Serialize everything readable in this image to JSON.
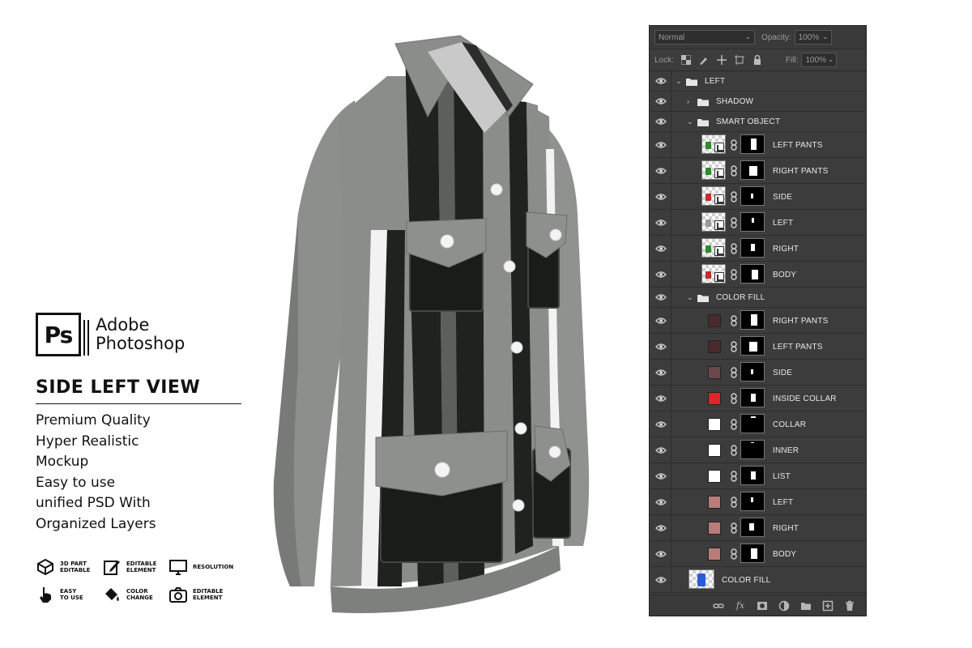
{
  "brand": {
    "logo_text": "Ps",
    "name_line1": "Adobe",
    "name_line2": "Photoshop"
  },
  "view_title": "SIDE LEFT VIEW",
  "features": [
    "Premium Quality",
    "Hyper Realistic",
    "Mockup",
    "Easy to use",
    "unified PSD With",
    "Organized Layers"
  ],
  "badges": [
    {
      "icon": "3d-cube-icon",
      "line1": "3D PART",
      "line2": "EDITABLE"
    },
    {
      "icon": "edit-icon",
      "line1": "EDITABLE",
      "line2": "ELEMENT"
    },
    {
      "icon": "monitor-icon",
      "line1": "RESOLUTION",
      "line2": ""
    },
    {
      "icon": "hand-pointer-icon",
      "line1": "EASY",
      "line2": "TO USE"
    },
    {
      "icon": "paint-bucket-icon",
      "line1": "COLOR",
      "line2": "CHANGE"
    },
    {
      "icon": "camera-icon",
      "line1": "EDITABLE",
      "line2": "ELEMENT"
    }
  ],
  "layers_panel": {
    "blend_mode": "Normal",
    "opacity_label": "Opacity:",
    "opacity_value": "100%",
    "lock_label": "Lock:",
    "fill_label": "Fill:",
    "fill_value": "100%",
    "layers": [
      {
        "name": "LEFT",
        "type": "group",
        "expanded": true
      },
      {
        "name": "SHADOW",
        "type": "group",
        "expanded": false
      },
      {
        "name": "SMART OBJECT",
        "type": "group",
        "expanded": true
      },
      {
        "name": "LEFT PANTS",
        "type": "smart"
      },
      {
        "name": "RIGHT PANTS",
        "type": "smart"
      },
      {
        "name": "SIDE",
        "type": "smart"
      },
      {
        "name": "LEFT",
        "type": "smart"
      },
      {
        "name": "RIGHT",
        "type": "smart"
      },
      {
        "name": "BODY",
        "type": "smart"
      },
      {
        "name": "COLOR FILL",
        "type": "group",
        "expanded": true
      },
      {
        "name": "RIGHT PANTS",
        "type": "fill",
        "color": "#4a2a2d"
      },
      {
        "name": "LEFT PANTS",
        "type": "fill",
        "color": "#4a2a2d"
      },
      {
        "name": "SIDE",
        "type": "fill",
        "color": "#6b464a"
      },
      {
        "name": "INSIDE COLLAR",
        "type": "fill",
        "color": "#e0222a"
      },
      {
        "name": "COLLAR",
        "type": "fill",
        "color": "#ffffff"
      },
      {
        "name": "INNER",
        "type": "fill",
        "color": "#ffffff"
      },
      {
        "name": "LIST",
        "type": "fill",
        "color": "#ffffff"
      },
      {
        "name": "LEFT",
        "type": "fill",
        "color": "#b87d7a"
      },
      {
        "name": "RIGHT",
        "type": "fill",
        "color": "#b87d7a"
      },
      {
        "name": "BODY",
        "type": "fill",
        "color": "#b87d7a"
      },
      {
        "name": "COLOR FILL",
        "type": "image"
      }
    ]
  },
  "colors": {
    "panel_bg": "#3c3c3c",
    "jacket_gray": "#8a8d8a",
    "jacket_black": "#1e2320",
    "stripe_white": "#f2f2f2"
  }
}
